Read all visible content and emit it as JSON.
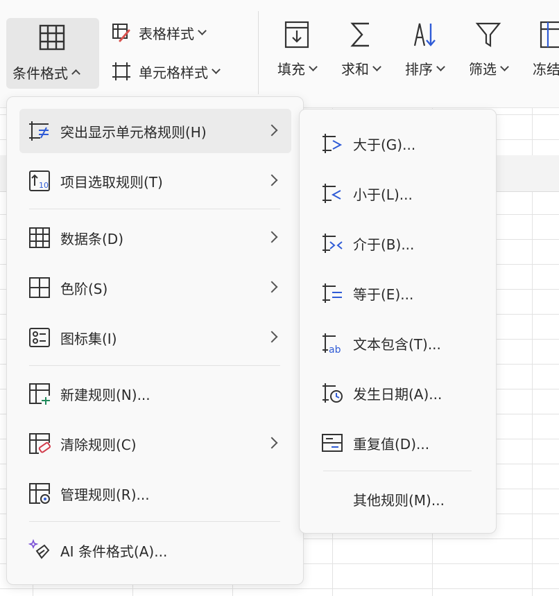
{
  "ribbon": {
    "conditional_format": "条件格式",
    "table_style": "表格样式",
    "cell_style": "单元格样式",
    "fill": "填充",
    "sum": "求和",
    "sort": "排序",
    "filter": "筛选",
    "freeze": "冻结"
  },
  "main_menu": {
    "items": [
      {
        "label": "突出显示单元格规则(H)",
        "icon": "highlight-rules-icon",
        "has_submenu": true,
        "highlighted": true
      },
      {
        "label": "项目选取规则(T)",
        "icon": "top-bottom-rules-icon",
        "has_submenu": true
      },
      {
        "label": "数据条(D)",
        "icon": "data-bars-icon",
        "has_submenu": true
      },
      {
        "label": "色阶(S)",
        "icon": "color-scales-icon",
        "has_submenu": true
      },
      {
        "label": "图标集(I)",
        "icon": "icon-sets-icon",
        "has_submenu": true
      },
      {
        "label": "新建规则(N)...",
        "icon": "new-rule-icon",
        "has_submenu": false
      },
      {
        "label": "清除规则(C)",
        "icon": "clear-rules-icon",
        "has_submenu": true
      },
      {
        "label": "管理规则(R)...",
        "icon": "manage-rules-icon",
        "has_submenu": false
      },
      {
        "label": "AI 条件格式(A)...",
        "icon": "ai-sparkle-icon",
        "has_submenu": false
      }
    ]
  },
  "sub_menu": {
    "items": [
      {
        "label": "大于(G)...",
        "icon": "greater-than-icon"
      },
      {
        "label": "小于(L)...",
        "icon": "less-than-icon"
      },
      {
        "label": "介于(B)...",
        "icon": "between-icon"
      },
      {
        "label": "等于(E)...",
        "icon": "equal-to-icon"
      },
      {
        "label": "文本包含(T)...",
        "icon": "text-contains-icon"
      },
      {
        "label": "发生日期(A)...",
        "icon": "date-occurring-icon"
      },
      {
        "label": "重复值(D)...",
        "icon": "duplicate-values-icon"
      }
    ],
    "more": "其他规则(M)..."
  },
  "colors": {
    "icon_stroke": "#333333",
    "icon_accent": "#2f5bd6",
    "clear_accent": "#d23b4b",
    "new_accent": "#1f8a5b"
  }
}
